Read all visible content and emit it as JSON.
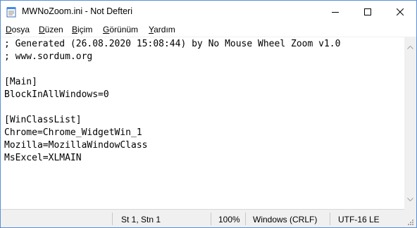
{
  "window": {
    "title": "MWNoZoom.ini - Not Defteri",
    "icon": "notepad-icon",
    "controls": [
      "minimize-icon",
      "maximize-icon",
      "close-icon"
    ]
  },
  "menu": {
    "items": [
      {
        "ul": "D",
        "rest": "osya"
      },
      {
        "ul": "D",
        "rest": "üzen"
      },
      {
        "ul": "B",
        "rest": "içim"
      },
      {
        "ul": "G",
        "rest": "örünüm"
      },
      {
        "ul": "Y",
        "rest": "ardım"
      }
    ]
  },
  "editor": {
    "lines": [
      "; Generated (26.08.2020 15:08:44) by No Mouse Wheel Zoom v1.0",
      "; www.sordum.org",
      "",
      "[Main]",
      "BlockInAllWindows=0",
      "",
      "[WinClassList]",
      "Chrome=Chrome_WidgetWin_1",
      "Mozilla=MozillaWindowClass",
      "MsExcel=XLMAIN"
    ]
  },
  "status": {
    "position": "St 1, Stn 1",
    "zoom": "100%",
    "line_ending": "Windows (CRLF)",
    "encoding": "UTF-16 LE"
  }
}
